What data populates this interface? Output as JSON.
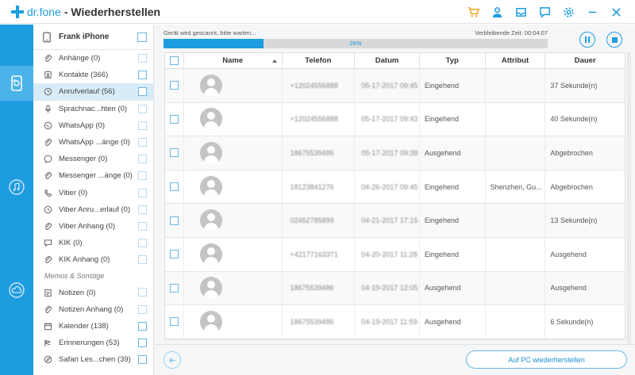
{
  "app": {
    "logo": "dr.fone",
    "title": "- Wiederherstellen",
    "window_icons": [
      "cart-icon",
      "user-icon",
      "inbox-icon",
      "feedback-icon",
      "settings-icon",
      "minimize-icon",
      "close-icon"
    ]
  },
  "device": {
    "name": "Frank iPhone"
  },
  "categories": [
    {
      "label": "Anhänge (0)",
      "icon": "paperclip-icon"
    },
    {
      "label": "Kontakte (366)",
      "icon": "contact-icon"
    },
    {
      "label": "Anrufverlauf (56)",
      "icon": "clock-icon",
      "active": true
    },
    {
      "label": "Sprachnac...hten (0)",
      "icon": "microphone-icon"
    },
    {
      "label": "WhatsApp (0)",
      "icon": "whatsapp-icon"
    },
    {
      "label": "WhatsApp ...änge (0)",
      "icon": "paperclip-icon"
    },
    {
      "label": "Messenger (0)",
      "icon": "messenger-icon"
    },
    {
      "label": "Messenger ...änge (0)",
      "icon": "paperclip-icon"
    },
    {
      "label": "Viber (0)",
      "icon": "phone-icon"
    },
    {
      "label": "Viber Anru...erlauf (0)",
      "icon": "clock-icon"
    },
    {
      "label": "Viber Anhang (0)",
      "icon": "paperclip-icon"
    },
    {
      "label": "KIK (0)",
      "icon": "chat-icon"
    },
    {
      "label": "KIK Anhang (0)",
      "icon": "paperclip-icon"
    }
  ],
  "memos_section": {
    "title": "Memos & Sonstige",
    "items": [
      {
        "label": "Notizen (0)",
        "icon": "note-icon"
      },
      {
        "label": "Notizen Anhang (0)",
        "icon": "paperclip-icon"
      },
      {
        "label": "Kalender (138)",
        "icon": "calendar-icon"
      },
      {
        "label": "Erinnerungen (53)",
        "icon": "reminder-icon"
      },
      {
        "label": "Safari Les...chen (39)",
        "icon": "bookmark-icon"
      }
    ]
  },
  "scan": {
    "status": "Gerät wird gescannt, bitte warten...",
    "remaining": "Verbleibende Zeit: 00:04:07",
    "progress": 26,
    "progress_label": "26%"
  },
  "table": {
    "columns": [
      "Name",
      "Telefon",
      "Datum",
      "Typ",
      "Attribut",
      "Dauer"
    ],
    "rows": [
      {
        "telefon": "+12024556888",
        "datum": "05-17-2017 09:45",
        "typ": "Eingehend",
        "attribut": "",
        "dauer": "37 Sekunde(n)"
      },
      {
        "telefon": "+12024556888",
        "datum": "05-17-2017 09:43",
        "typ": "Eingehend",
        "attribut": "",
        "dauer": "40 Sekunde(n)"
      },
      {
        "telefon": "18675539486",
        "datum": "05-17-2017 09:38",
        "typ": "Ausgehend",
        "attribut": "",
        "dauer": "Abgebrochen"
      },
      {
        "telefon": "18123841276",
        "datum": "04-26-2017 09:45",
        "typ": "Eingehend",
        "attribut": "Shenzhen, Gu...",
        "dauer": "Abgebrochen"
      },
      {
        "telefon": "02462785899",
        "datum": "04-21-2017 17:15",
        "typ": "Eingehend",
        "attribut": "",
        "dauer": "13 Sekunde(n)"
      },
      {
        "telefon": "+42177163371",
        "datum": "04-20-2017 11:28",
        "typ": "Eingehend",
        "attribut": "",
        "dauer": "Ausgehend"
      },
      {
        "telefon": "18675539486",
        "datum": "04-19-2017 12:05",
        "typ": "Ausgehend",
        "attribut": "",
        "dauer": "Ausgehend"
      },
      {
        "telefon": "18675539486",
        "datum": "04-19-2017 11:59",
        "typ": "Ausgehend",
        "attribut": "",
        "dauer": "6 Sekunde(n)"
      }
    ]
  },
  "footer": {
    "restore_label": "Auf PC wiederherstellen"
  },
  "colors": {
    "accent": "#1e9ce0",
    "rail": "#1e9ce0",
    "active_row": "#d8ecf8"
  }
}
